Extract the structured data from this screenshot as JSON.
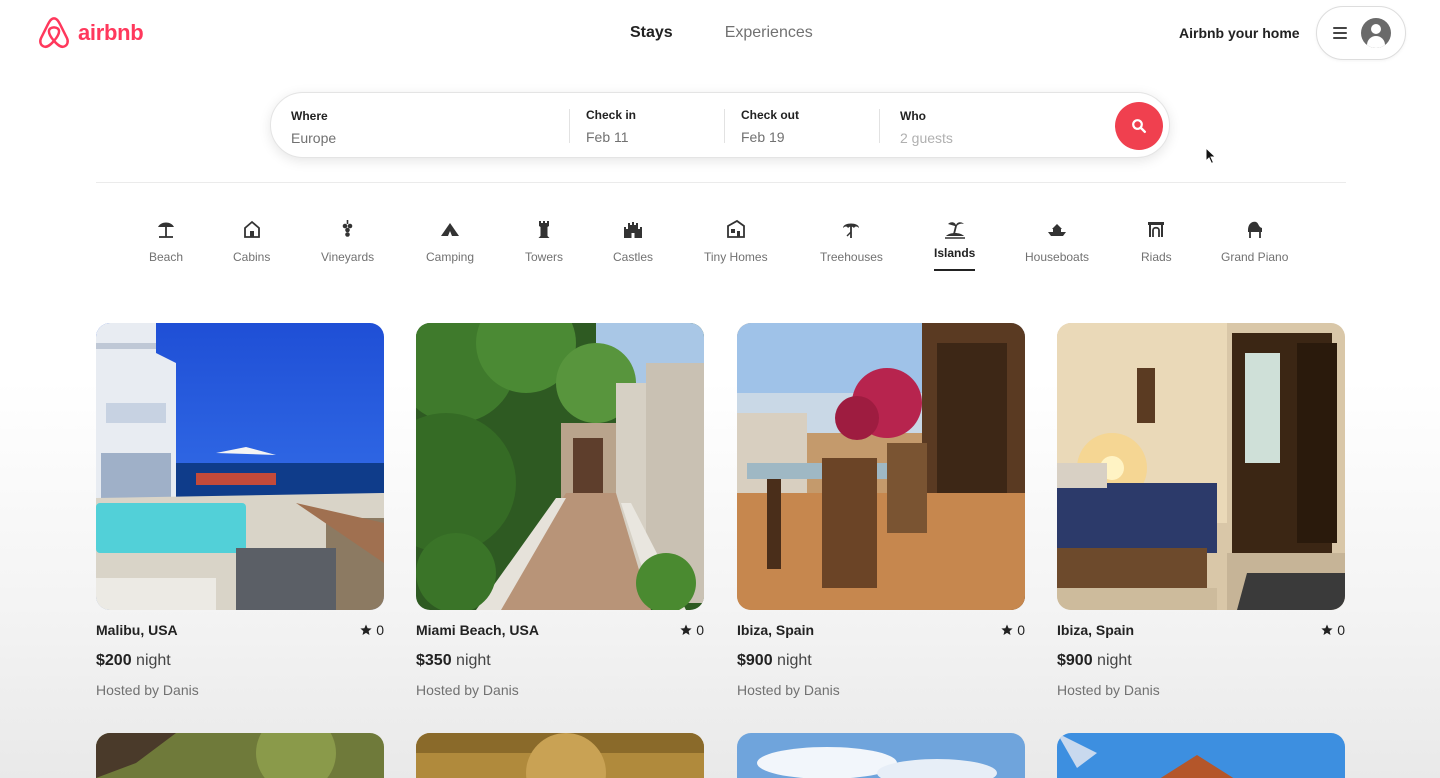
{
  "brand": {
    "name": "airbnb",
    "color": "#ff385c"
  },
  "nav": {
    "tabs": [
      "Stays",
      "Experiences"
    ],
    "active": "Stays"
  },
  "header": {
    "host_link": "Airbnb your home",
    "menu_icon": "hamburger-icon",
    "avatar_icon": "user-avatar-icon"
  },
  "search": {
    "where": {
      "label": "Where",
      "value": "Europe"
    },
    "checkin": {
      "label": "Check in",
      "value": "Feb 11"
    },
    "checkout": {
      "label": "Check out",
      "value": "Feb 19"
    },
    "who": {
      "label": "Who",
      "placeholder": "2 guests"
    },
    "button_icon": "search-icon",
    "button_color": "#f0404f"
  },
  "categories": [
    {
      "label": "Beach",
      "icon": "beach-umbrella-icon"
    },
    {
      "label": "Cabins",
      "icon": "house-icon"
    },
    {
      "label": "Vineyards",
      "icon": "grapes-icon"
    },
    {
      "label": "Camping",
      "icon": "tent-icon"
    },
    {
      "label": "Towers",
      "icon": "tower-icon"
    },
    {
      "label": "Castles",
      "icon": "castle-icon"
    },
    {
      "label": "Tiny Homes",
      "icon": "tiny-home-icon"
    },
    {
      "label": "Treehouses",
      "icon": "treehouse-icon"
    },
    {
      "label": "Islands",
      "icon": "island-icon",
      "active": true
    },
    {
      "label": "Houseboats",
      "icon": "houseboat-icon"
    },
    {
      "label": "Riads",
      "icon": "riad-icon"
    },
    {
      "label": "Grand Piano",
      "icon": "piano-icon"
    }
  ],
  "listings": [
    {
      "location": "Malibu, USA",
      "rating": "0",
      "price": "$200",
      "unit": "night",
      "host": "Hosted by Danis"
    },
    {
      "location": "Miami Beach, USA",
      "rating": "0",
      "price": "$350",
      "unit": "night",
      "host": "Hosted by Danis"
    },
    {
      "location": "Ibiza, Spain",
      "rating": "0",
      "price": "$900",
      "unit": "night",
      "host": "Hosted by Danis"
    },
    {
      "location": "Ibiza, Spain",
      "rating": "0",
      "price": "$900",
      "unit": "night",
      "host": "Hosted by Danis"
    }
  ]
}
